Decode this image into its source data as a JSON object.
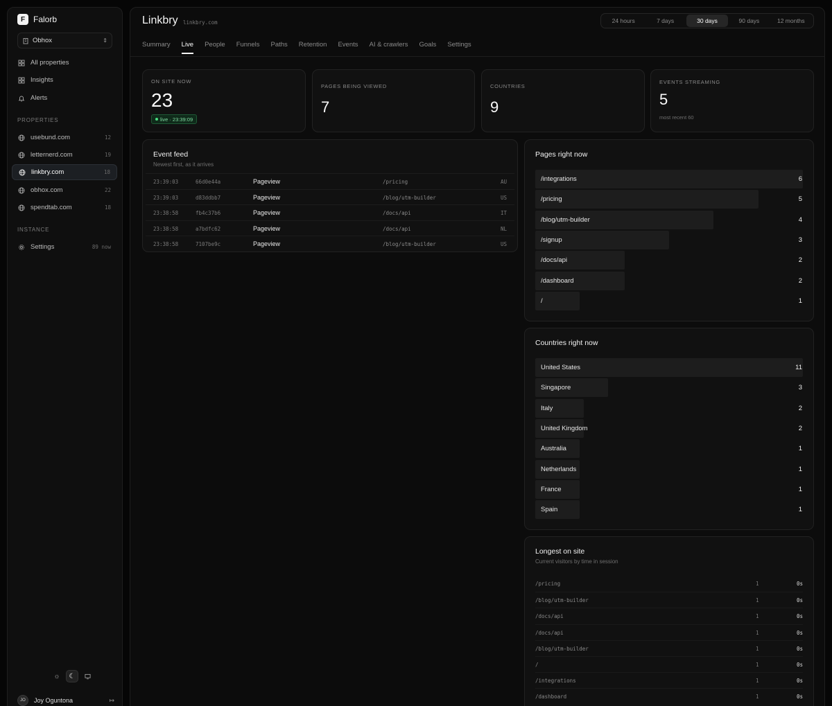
{
  "app": {
    "name": "Falorb",
    "logo_letter": "F"
  },
  "org": {
    "name": "Obhox"
  },
  "nav": [
    {
      "label": "All properties",
      "icon": "grid-icon"
    },
    {
      "label": "Insights",
      "icon": "grid-icon"
    },
    {
      "label": "Alerts",
      "icon": "bell-icon"
    }
  ],
  "properties_label": "PROPERTIES",
  "properties": [
    {
      "label": "usebund.com",
      "count": "12"
    },
    {
      "label": "letternerd.com",
      "count": "19"
    },
    {
      "label": "linkbry.com",
      "count": "18",
      "active": true
    },
    {
      "label": "obhox.com",
      "count": "22"
    },
    {
      "label": "spendtab.com",
      "count": "18"
    }
  ],
  "instance_label": "INSTANCE",
  "settings": {
    "label": "Settings",
    "meta": "89 now"
  },
  "user": {
    "initials": "JO",
    "name": "Joy Oguntona"
  },
  "header": {
    "title": "Linkbry",
    "domain": "linkbry.com"
  },
  "ranges": [
    "24 hours",
    "7 days",
    "30 days",
    "90 days",
    "12 months"
  ],
  "active_range": "30 days",
  "tabs": [
    "Summary",
    "Live",
    "People",
    "Funnels",
    "Paths",
    "Retention",
    "Events",
    "AI & crawlers",
    "Goals",
    "Settings"
  ],
  "active_tab": "Live",
  "stats": {
    "on_site": {
      "label": "ON SITE NOW",
      "value": "23",
      "badge": "live · 23:39:09"
    },
    "pages": {
      "label": "PAGES BEING VIEWED",
      "value": "7"
    },
    "countries": {
      "label": "COUNTRIES",
      "value": "9"
    },
    "events": {
      "label": "EVENTS STREAMING",
      "value": "5",
      "sub": "most recent 60"
    }
  },
  "feed": {
    "title": "Event feed",
    "subtitle": "Newest first, as it arrives",
    "rows": [
      {
        "time": "23:39:03",
        "id": "66d0e44a",
        "type": "Pageview",
        "path": "/pricing",
        "cc": "AU"
      },
      {
        "time": "23:39:03",
        "id": "d83ddbb7",
        "type": "Pageview",
        "path": "/blog/utm-builder",
        "cc": "US"
      },
      {
        "time": "23:38:58",
        "id": "fb4c37b6",
        "type": "Pageview",
        "path": "/docs/api",
        "cc": "IT"
      },
      {
        "time": "23:38:58",
        "id": "a7bdfc62",
        "type": "Pageview",
        "path": "/docs/api",
        "cc": "NL"
      },
      {
        "time": "23:38:58",
        "id": "7107be9c",
        "type": "Pageview",
        "path": "/blog/utm-builder",
        "cc": "US"
      }
    ]
  },
  "pages_now": {
    "title": "Pages right now",
    "rows": [
      {
        "label": "/integrations",
        "value": 6
      },
      {
        "label": "/pricing",
        "value": 5
      },
      {
        "label": "/blog/utm-builder",
        "value": 4
      },
      {
        "label": "/signup",
        "value": 3
      },
      {
        "label": "/docs/api",
        "value": 2
      },
      {
        "label": "/dashboard",
        "value": 2
      },
      {
        "label": "/",
        "value": 1
      }
    ]
  },
  "countries_now": {
    "title": "Countries right now",
    "rows": [
      {
        "label": "United States",
        "value": 11
      },
      {
        "label": "Singapore",
        "value": 3
      },
      {
        "label": "Italy",
        "value": 2
      },
      {
        "label": "United Kingdom",
        "value": 2
      },
      {
        "label": "Australia",
        "value": 1
      },
      {
        "label": "Netherlands",
        "value": 1
      },
      {
        "label": "France",
        "value": 1
      },
      {
        "label": "Spain",
        "value": 1
      }
    ]
  },
  "longest": {
    "title": "Longest on site",
    "subtitle": "Current visitors by time in session",
    "rows": [
      {
        "path": "/pricing",
        "count": "1",
        "time": "0s"
      },
      {
        "path": "/blog/utm-builder",
        "count": "1",
        "time": "0s"
      },
      {
        "path": "/docs/api",
        "count": "1",
        "time": "0s"
      },
      {
        "path": "/docs/api",
        "count": "1",
        "time": "0s"
      },
      {
        "path": "/blog/utm-builder",
        "count": "1",
        "time": "0s"
      },
      {
        "path": "/",
        "count": "1",
        "time": "0s"
      },
      {
        "path": "/integrations",
        "count": "1",
        "time": "0s"
      },
      {
        "path": "/dashboard",
        "count": "1",
        "time": "0s"
      }
    ]
  },
  "colors": {
    "live_green": "#4ade80",
    "bar": "#1d1d1d",
    "active_nav": "#1c1f23"
  }
}
